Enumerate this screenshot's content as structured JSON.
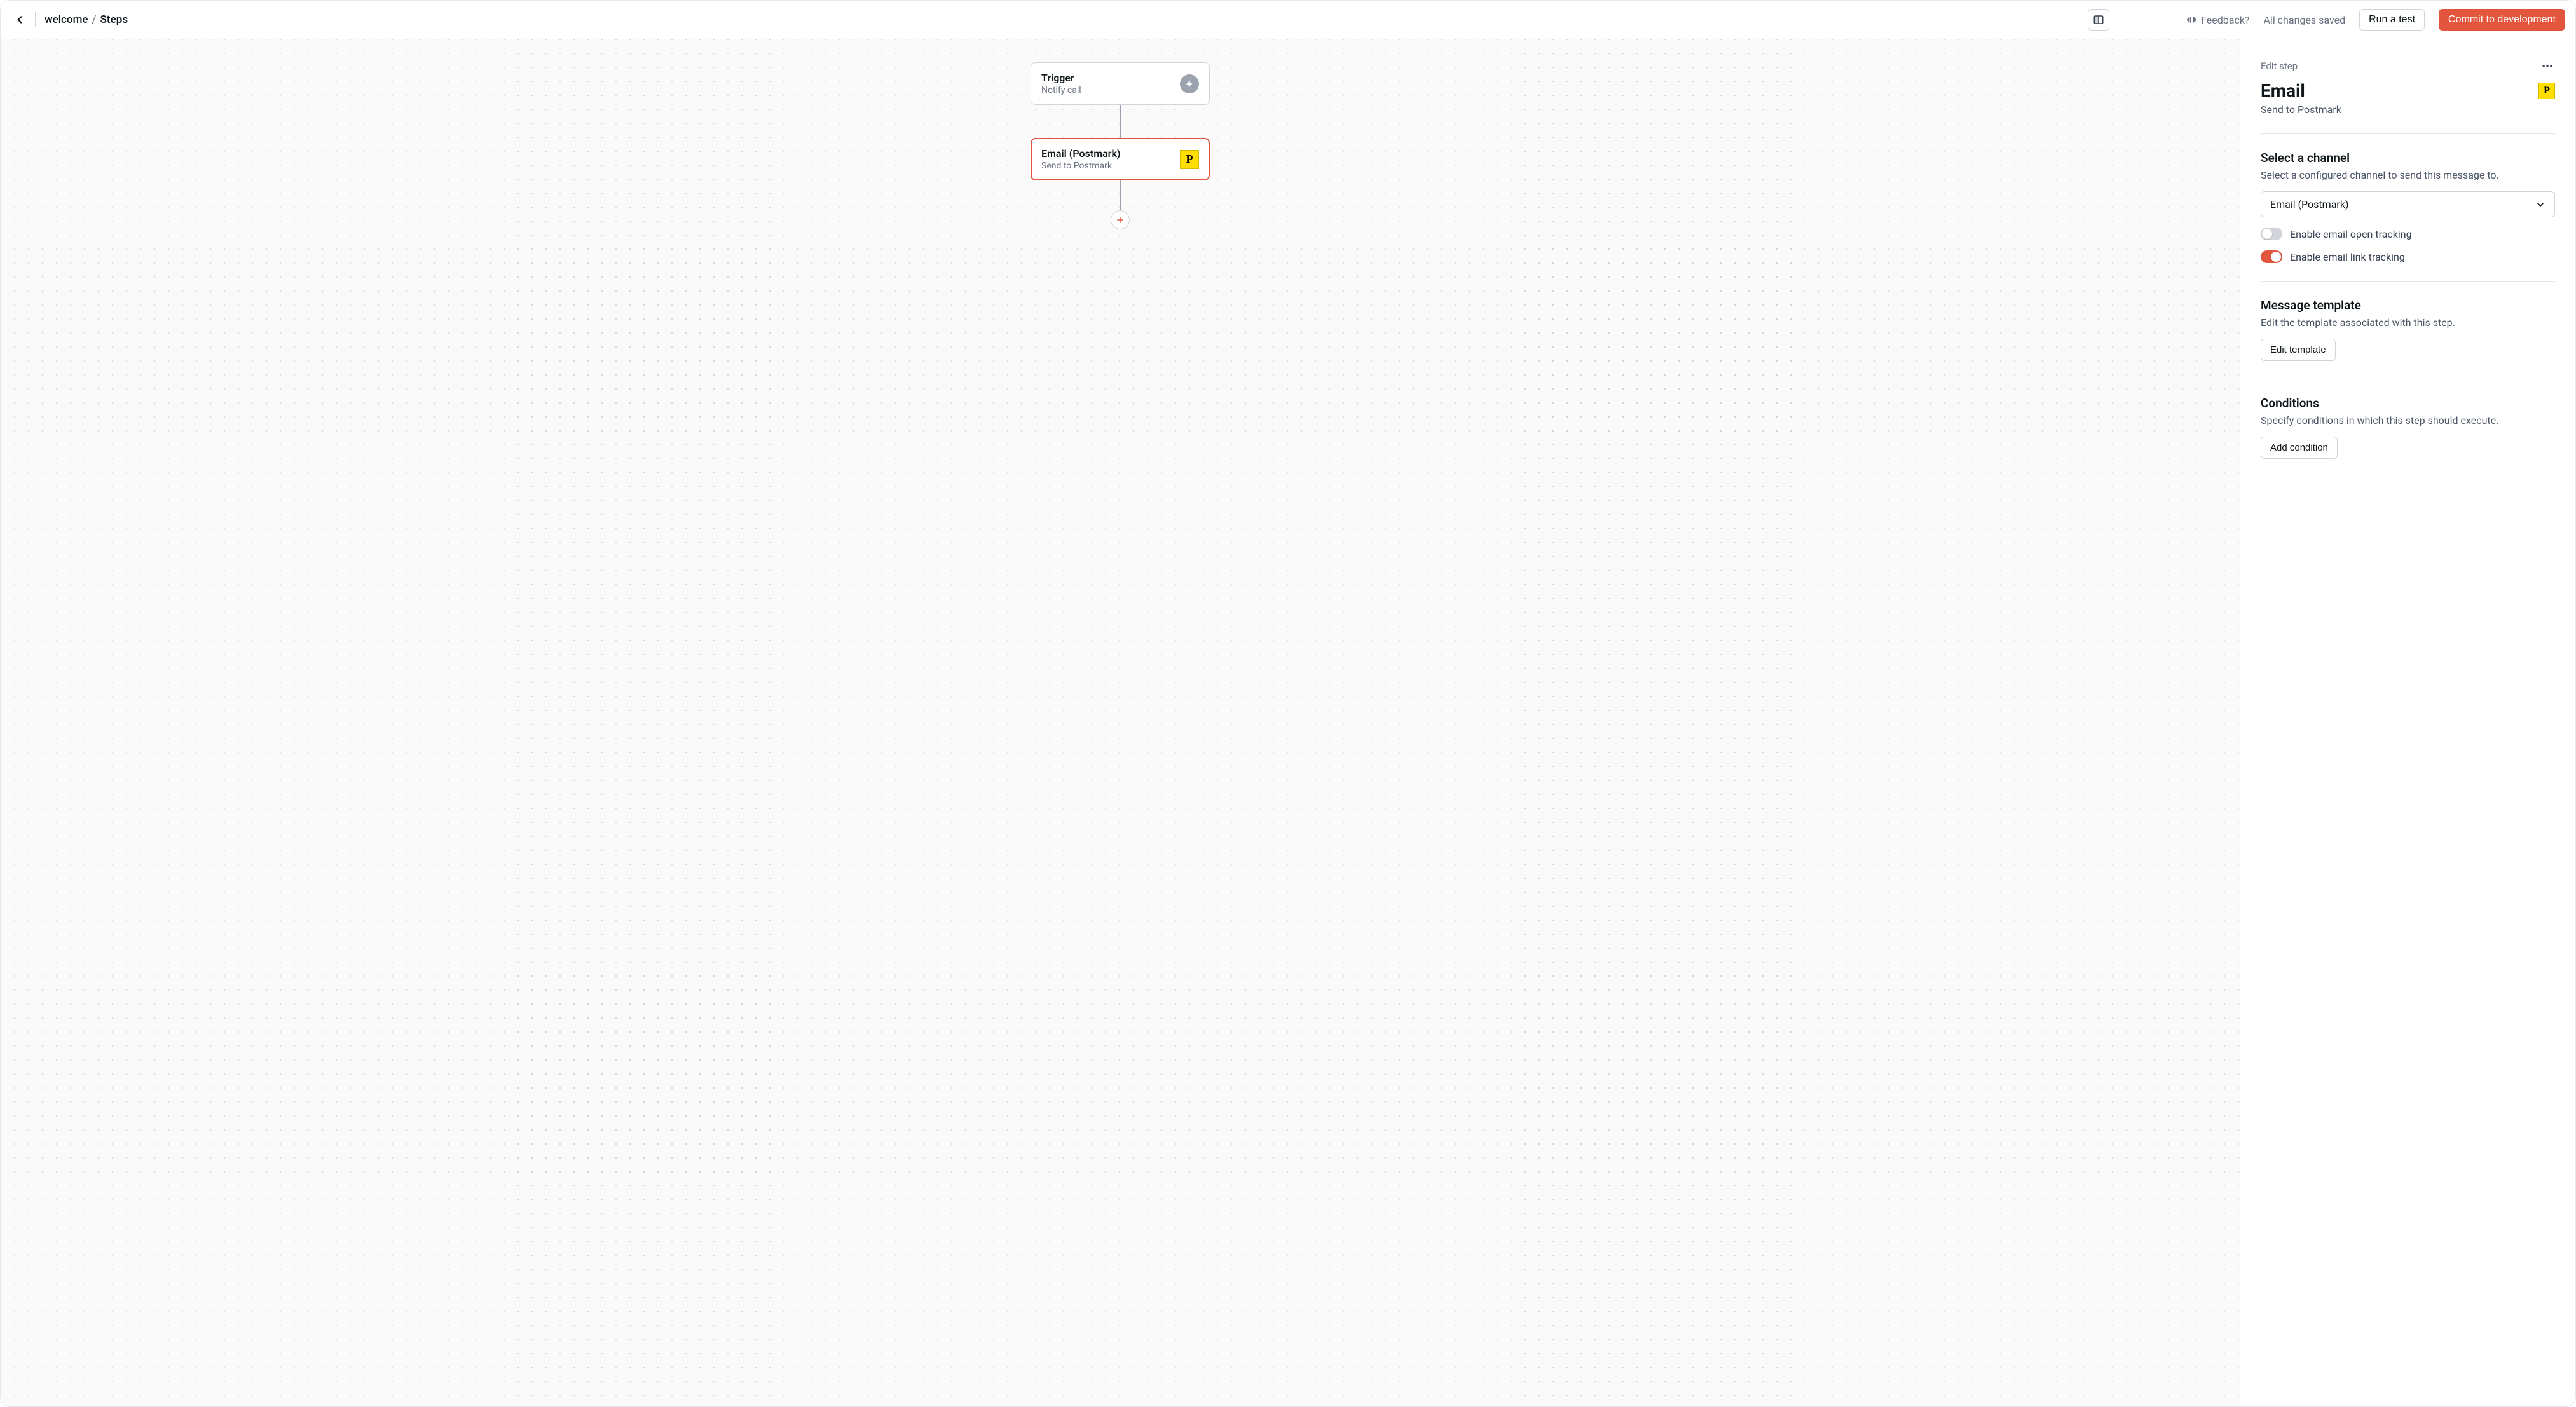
{
  "header": {
    "breadcrumb_root": "welcome",
    "breadcrumb_sep": "/",
    "breadcrumb_current": "Steps",
    "feedback_label": "Feedback?",
    "saved_label": "All changes saved",
    "run_test_label": "Run a test",
    "commit_label": "Commit to development"
  },
  "flow": {
    "trigger": {
      "title": "Trigger",
      "subtitle": "Notify call"
    },
    "email": {
      "title": "Email (Postmark)",
      "subtitle": "Send to Postmark"
    }
  },
  "panel": {
    "eyebrow": "Edit step",
    "title": "Email",
    "subtitle": "Send to Postmark",
    "channel": {
      "heading": "Select a channel",
      "description": "Select a configured channel to send this message to.",
      "selected": "Email (Postmark)",
      "open_tracking_label": "Enable email open tracking",
      "link_tracking_label": "Enable email link tracking"
    },
    "template": {
      "heading": "Message template",
      "description": "Edit the template associated with this step.",
      "button": "Edit template"
    },
    "conditions": {
      "heading": "Conditions",
      "description": "Specify conditions in which this step should execute.",
      "button": "Add condition"
    }
  },
  "postmark_glyph": "P"
}
